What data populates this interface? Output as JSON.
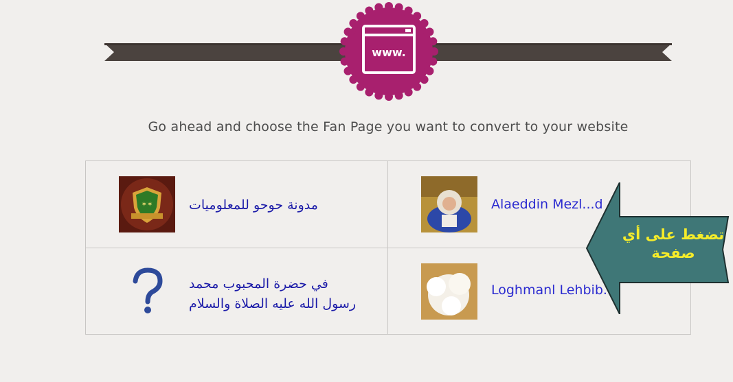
{
  "header": {
    "badge_label": "www.",
    "tagline": "Go ahead and choose the Fan Page you want to convert to your website"
  },
  "pages": [
    {
      "name": "مدونة حوحو للمعلوميات",
      "thumb": "shield-logo-icon"
    },
    {
      "name": "Alaeddin Mezl...d",
      "thumb": "child-photo"
    },
    {
      "name_line1": "في حضرة المحبوب محمد",
      "name_line2": "رسول الله عليه الصلاة والسلام",
      "thumb": "question-mark-icon"
    },
    {
      "name": "Loghmanl Lehbib...",
      "thumb": "flower-photo"
    }
  ],
  "callout": {
    "line1": "تضغط على أي",
    "line2": "صفحة",
    "color": "#3f7777",
    "text_color": "#f5ec2a"
  },
  "colors": {
    "badge": "#a8206e",
    "ribbon": "#4b433f",
    "link": "#1a1aa8"
  }
}
